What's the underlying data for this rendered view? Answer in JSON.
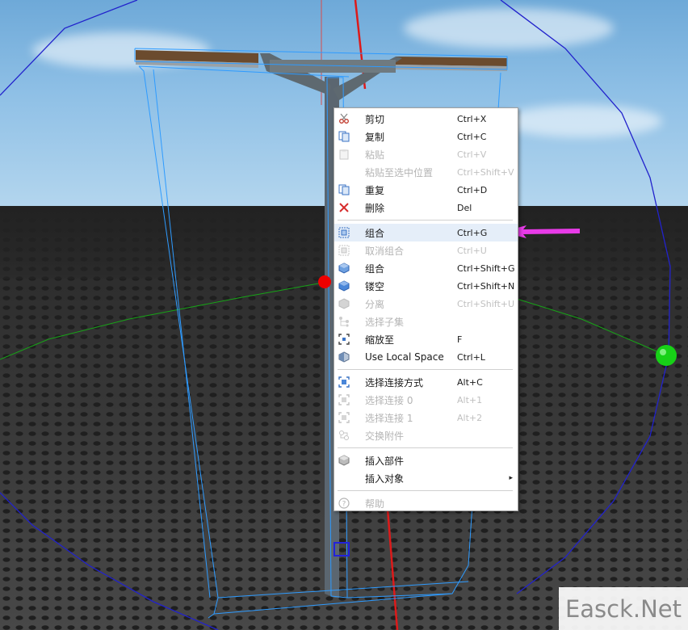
{
  "context_menu": {
    "items": [
      {
        "label": "剪切",
        "shortcut": "Ctrl+X",
        "icon": "scissors-icon",
        "enabled": true
      },
      {
        "label": "复制",
        "shortcut": "Ctrl+C",
        "icon": "copy-icon",
        "enabled": true
      },
      {
        "label": "粘贴",
        "shortcut": "Ctrl+V",
        "icon": "paste-icon",
        "enabled": false
      },
      {
        "label": "粘贴至选中位置",
        "shortcut": "Ctrl+Shift+V",
        "icon": "",
        "enabled": false
      },
      {
        "label": "重复",
        "shortcut": "Ctrl+D",
        "icon": "duplicate-icon",
        "enabled": true
      },
      {
        "label": "删除",
        "shortcut": "Del",
        "icon": "delete-icon",
        "enabled": true
      },
      {
        "label": "组合",
        "shortcut": "Ctrl+G",
        "icon": "group-icon",
        "enabled": true,
        "highlighted": true
      },
      {
        "label": "取消组合",
        "shortcut": "Ctrl+U",
        "icon": "ungroup-icon",
        "enabled": false
      },
      {
        "label": "组合",
        "shortcut": "Ctrl+Shift+G",
        "icon": "union-icon",
        "enabled": true
      },
      {
        "label": "镂空",
        "shortcut": "Ctrl+Shift+N",
        "icon": "negate-icon",
        "enabled": true
      },
      {
        "label": "分离",
        "shortcut": "Ctrl+Shift+U",
        "icon": "separate-icon",
        "enabled": false
      },
      {
        "label": "选择子集",
        "shortcut": "",
        "icon": "select-children-icon",
        "enabled": false
      },
      {
        "label": "缩放至",
        "shortcut": "F",
        "icon": "zoom-to-icon",
        "enabled": true
      },
      {
        "label": "Use Local Space",
        "shortcut": "Ctrl+L",
        "icon": "local-space-icon",
        "enabled": true
      },
      {
        "label": "选择连接方式",
        "shortcut": "Alt+C",
        "icon": "select-connection-icon",
        "enabled": true
      },
      {
        "label": "选择连接 0",
        "shortcut": "Alt+1",
        "icon": "select-connection-0-icon",
        "enabled": false
      },
      {
        "label": "选择连接 1",
        "shortcut": "Alt+2",
        "icon": "select-connection-1-icon",
        "enabled": false
      },
      {
        "label": "交换附件",
        "shortcut": "",
        "icon": "swap-attachment-icon",
        "enabled": false
      },
      {
        "label": "插入部件",
        "shortcut": "",
        "icon": "insert-part-icon",
        "enabled": true
      },
      {
        "label": "插入对象",
        "shortcut": "",
        "icon": "",
        "enabled": true,
        "submenu": true
      },
      {
        "label": "帮助",
        "shortcut": "",
        "icon": "help-icon",
        "enabled": false
      }
    ],
    "submenu_glyph": "▸"
  },
  "watermark": "Easck.Net",
  "colors": {
    "highlight": "#e5eef9",
    "arrow": "#e83be8",
    "selection": "#2e9bff",
    "gizmo_red": "#ff1a1a",
    "gizmo_green": "#17d117",
    "gizmo_blue": "#2222cc"
  }
}
